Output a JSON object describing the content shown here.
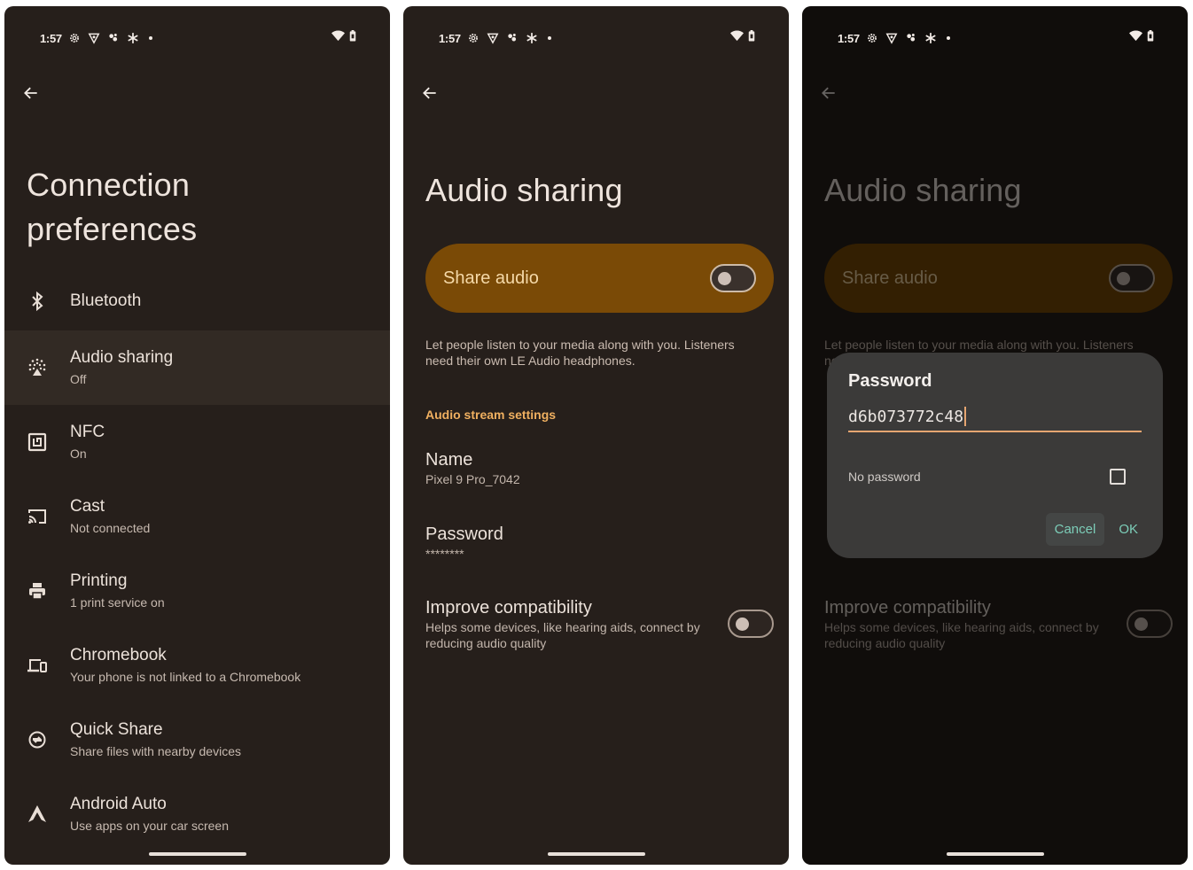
{
  "status_bar": {
    "time": "1:57",
    "left_icons": [
      "settings-gear-icon",
      "vpn-shield-icon",
      "fan-icon",
      "snowflake-icon",
      "notification-dot"
    ],
    "right_icons": [
      "wifi-icon",
      "battery-icon"
    ]
  },
  "screen1": {
    "title": "Connection preferences",
    "items": [
      {
        "icon": "bluetooth-icon",
        "label": "Bluetooth",
        "sub": ""
      },
      {
        "icon": "audio-sharing-icon",
        "label": "Audio sharing",
        "sub": "Off"
      },
      {
        "icon": "nfc-icon",
        "label": "NFC",
        "sub": "On"
      },
      {
        "icon": "cast-icon",
        "label": "Cast",
        "sub": "Not connected"
      },
      {
        "icon": "printer-icon",
        "label": "Printing",
        "sub": "1 print service on"
      },
      {
        "icon": "chromebook-icon",
        "label": "Chromebook",
        "sub": "Your phone is not linked to a Chromebook"
      },
      {
        "icon": "quick-share-icon",
        "label": "Quick Share",
        "sub": "Share files with nearby devices"
      },
      {
        "icon": "android-auto-icon",
        "label": "Android Auto",
        "sub": "Use apps on your car screen"
      }
    ]
  },
  "screen2": {
    "title": "Audio sharing",
    "share_audio": {
      "label": "Share audio",
      "enabled": false
    },
    "description": "Let people listen to your media along with you. Listeners need their own LE Audio headphones.",
    "section_header": "Audio stream settings",
    "name": {
      "label": "Name",
      "value": "Pixel 9 Pro_7042"
    },
    "password": {
      "label": "Password",
      "value": "********"
    },
    "improve_compat": {
      "label": "Improve compatibility",
      "sub": "Helps some devices, like hearing aids, connect by reducing audio quality",
      "enabled": false
    }
  },
  "screen3": {
    "title": "Audio sharing",
    "share_audio_label": "Share audio",
    "description": "Let people listen to your media along with you. Listeners need their own LE Audio headphones.",
    "improve_compat": {
      "label": "Improve compatibility",
      "sub": "Helps some devices, like hearing aids, connect by reducing audio quality"
    },
    "dialog": {
      "title": "Password",
      "input_value": "d6b073772c48",
      "no_password_label": "No password",
      "no_password_checked": false,
      "cancel_label": "Cancel",
      "ok_label": "OK"
    }
  },
  "colors": {
    "background": "#261f1b",
    "accent_card": "#7a4a06",
    "accent_text": "#f0b060",
    "dialog_bg": "#3b3a39",
    "dialog_button": "#7ccdb8",
    "input_underline": "#e5a571"
  }
}
